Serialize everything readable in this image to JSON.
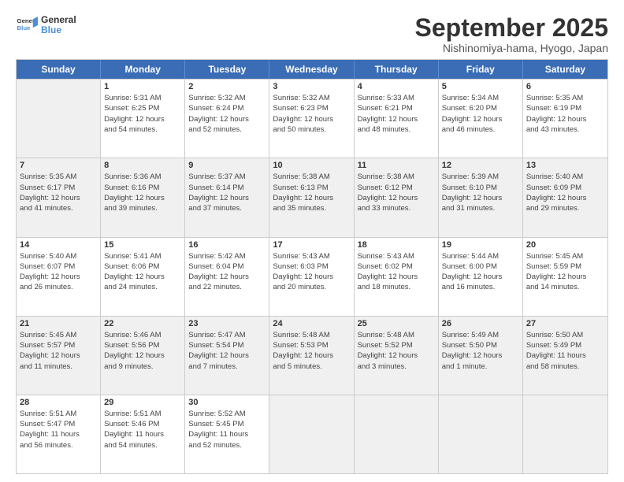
{
  "header": {
    "logo_line1": "General",
    "logo_line2": "Blue",
    "month": "September 2025",
    "location": "Nishinomiya-hama, Hyogo, Japan"
  },
  "weekdays": [
    "Sunday",
    "Monday",
    "Tuesday",
    "Wednesday",
    "Thursday",
    "Friday",
    "Saturday"
  ],
  "rows": [
    [
      {
        "day": "",
        "lines": []
      },
      {
        "day": "1",
        "lines": [
          "Sunrise: 5:31 AM",
          "Sunset: 6:25 PM",
          "Daylight: 12 hours",
          "and 54 minutes."
        ]
      },
      {
        "day": "2",
        "lines": [
          "Sunrise: 5:32 AM",
          "Sunset: 6:24 PM",
          "Daylight: 12 hours",
          "and 52 minutes."
        ]
      },
      {
        "day": "3",
        "lines": [
          "Sunrise: 5:32 AM",
          "Sunset: 6:23 PM",
          "Daylight: 12 hours",
          "and 50 minutes."
        ]
      },
      {
        "day": "4",
        "lines": [
          "Sunrise: 5:33 AM",
          "Sunset: 6:21 PM",
          "Daylight: 12 hours",
          "and 48 minutes."
        ]
      },
      {
        "day": "5",
        "lines": [
          "Sunrise: 5:34 AM",
          "Sunset: 6:20 PM",
          "Daylight: 12 hours",
          "and 46 minutes."
        ]
      },
      {
        "day": "6",
        "lines": [
          "Sunrise: 5:35 AM",
          "Sunset: 6:19 PM",
          "Daylight: 12 hours",
          "and 43 minutes."
        ]
      }
    ],
    [
      {
        "day": "7",
        "lines": [
          "Sunrise: 5:35 AM",
          "Sunset: 6:17 PM",
          "Daylight: 12 hours",
          "and 41 minutes."
        ]
      },
      {
        "day": "8",
        "lines": [
          "Sunrise: 5:36 AM",
          "Sunset: 6:16 PM",
          "Daylight: 12 hours",
          "and 39 minutes."
        ]
      },
      {
        "day": "9",
        "lines": [
          "Sunrise: 5:37 AM",
          "Sunset: 6:14 PM",
          "Daylight: 12 hours",
          "and 37 minutes."
        ]
      },
      {
        "day": "10",
        "lines": [
          "Sunrise: 5:38 AM",
          "Sunset: 6:13 PM",
          "Daylight: 12 hours",
          "and 35 minutes."
        ]
      },
      {
        "day": "11",
        "lines": [
          "Sunrise: 5:38 AM",
          "Sunset: 6:12 PM",
          "Daylight: 12 hours",
          "and 33 minutes."
        ]
      },
      {
        "day": "12",
        "lines": [
          "Sunrise: 5:39 AM",
          "Sunset: 6:10 PM",
          "Daylight: 12 hours",
          "and 31 minutes."
        ]
      },
      {
        "day": "13",
        "lines": [
          "Sunrise: 5:40 AM",
          "Sunset: 6:09 PM",
          "Daylight: 12 hours",
          "and 29 minutes."
        ]
      }
    ],
    [
      {
        "day": "14",
        "lines": [
          "Sunrise: 5:40 AM",
          "Sunset: 6:07 PM",
          "Daylight: 12 hours",
          "and 26 minutes."
        ]
      },
      {
        "day": "15",
        "lines": [
          "Sunrise: 5:41 AM",
          "Sunset: 6:06 PM",
          "Daylight: 12 hours",
          "and 24 minutes."
        ]
      },
      {
        "day": "16",
        "lines": [
          "Sunrise: 5:42 AM",
          "Sunset: 6:04 PM",
          "Daylight: 12 hours",
          "and 22 minutes."
        ]
      },
      {
        "day": "17",
        "lines": [
          "Sunrise: 5:43 AM",
          "Sunset: 6:03 PM",
          "Daylight: 12 hours",
          "and 20 minutes."
        ]
      },
      {
        "day": "18",
        "lines": [
          "Sunrise: 5:43 AM",
          "Sunset: 6:02 PM",
          "Daylight: 12 hours",
          "and 18 minutes."
        ]
      },
      {
        "day": "19",
        "lines": [
          "Sunrise: 5:44 AM",
          "Sunset: 6:00 PM",
          "Daylight: 12 hours",
          "and 16 minutes."
        ]
      },
      {
        "day": "20",
        "lines": [
          "Sunrise: 5:45 AM",
          "Sunset: 5:59 PM",
          "Daylight: 12 hours",
          "and 14 minutes."
        ]
      }
    ],
    [
      {
        "day": "21",
        "lines": [
          "Sunrise: 5:45 AM",
          "Sunset: 5:57 PM",
          "Daylight: 12 hours",
          "and 11 minutes."
        ]
      },
      {
        "day": "22",
        "lines": [
          "Sunrise: 5:46 AM",
          "Sunset: 5:56 PM",
          "Daylight: 12 hours",
          "and 9 minutes."
        ]
      },
      {
        "day": "23",
        "lines": [
          "Sunrise: 5:47 AM",
          "Sunset: 5:54 PM",
          "Daylight: 12 hours",
          "and 7 minutes."
        ]
      },
      {
        "day": "24",
        "lines": [
          "Sunrise: 5:48 AM",
          "Sunset: 5:53 PM",
          "Daylight: 12 hours",
          "and 5 minutes."
        ]
      },
      {
        "day": "25",
        "lines": [
          "Sunrise: 5:48 AM",
          "Sunset: 5:52 PM",
          "Daylight: 12 hours",
          "and 3 minutes."
        ]
      },
      {
        "day": "26",
        "lines": [
          "Sunrise: 5:49 AM",
          "Sunset: 5:50 PM",
          "Daylight: 12 hours",
          "and 1 minute."
        ]
      },
      {
        "day": "27",
        "lines": [
          "Sunrise: 5:50 AM",
          "Sunset: 5:49 PM",
          "Daylight: 11 hours",
          "and 58 minutes."
        ]
      }
    ],
    [
      {
        "day": "28",
        "lines": [
          "Sunrise: 5:51 AM",
          "Sunset: 5:47 PM",
          "Daylight: 11 hours",
          "and 56 minutes."
        ]
      },
      {
        "day": "29",
        "lines": [
          "Sunrise: 5:51 AM",
          "Sunset: 5:46 PM",
          "Daylight: 11 hours",
          "and 54 minutes."
        ]
      },
      {
        "day": "30",
        "lines": [
          "Sunrise: 5:52 AM",
          "Sunset: 5:45 PM",
          "Daylight: 11 hours",
          "and 52 minutes."
        ]
      },
      {
        "day": "",
        "lines": []
      },
      {
        "day": "",
        "lines": []
      },
      {
        "day": "",
        "lines": []
      },
      {
        "day": "",
        "lines": []
      }
    ]
  ]
}
